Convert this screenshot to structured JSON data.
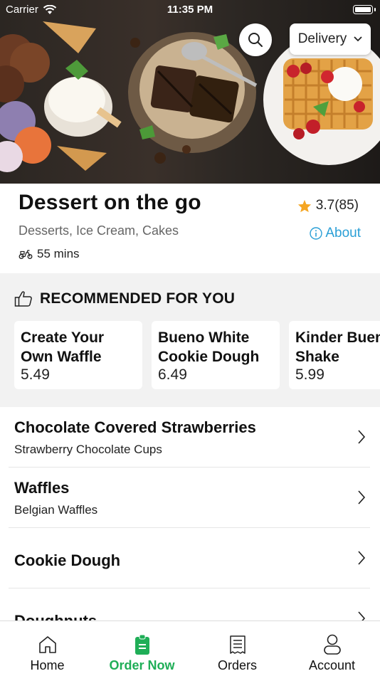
{
  "status_bar": {
    "carrier": "Carrier",
    "time": "11:35 PM"
  },
  "header": {
    "delivery_mode": "Delivery",
    "search_icon": "search-icon",
    "chevron_icon": "chevron-down-icon"
  },
  "store": {
    "name": "Dessert on the go",
    "categories": "Desserts, Ice Cream, Cakes",
    "rating": "3.7(85)",
    "about": "About",
    "eta": "55 mins",
    "star_color": "#f5a623",
    "link_color": "#2a9fd6"
  },
  "recommended": {
    "heading": "RECOMMENDED FOR YOU",
    "items": [
      {
        "name_line1": "Create Your",
        "name_line2": "Own Waffle",
        "price": "5.49"
      },
      {
        "name_line1": "Bueno White",
        "name_line2": "Cookie Dough",
        "price": "6.49"
      },
      {
        "name_line1": "Kinder Bueno",
        "name_line2": "Shake",
        "price": "5.99"
      }
    ]
  },
  "menu": [
    {
      "title": "Chocolate Covered Strawberries",
      "subtitle": "Strawberry Chocolate Cups"
    },
    {
      "title": "Waffles",
      "subtitle": "Belgian Waffles"
    },
    {
      "title": "Cookie Dough",
      "subtitle": ""
    },
    {
      "title": "Doughnuts",
      "subtitle": ""
    }
  ],
  "tabbar": {
    "accent": "#1fae57",
    "tabs": [
      {
        "label": "Home",
        "icon": "home-icon"
      },
      {
        "label": "Order Now",
        "icon": "order-icon"
      },
      {
        "label": "Orders",
        "icon": "receipt-icon"
      },
      {
        "label": "Account",
        "icon": "person-icon"
      }
    ]
  }
}
